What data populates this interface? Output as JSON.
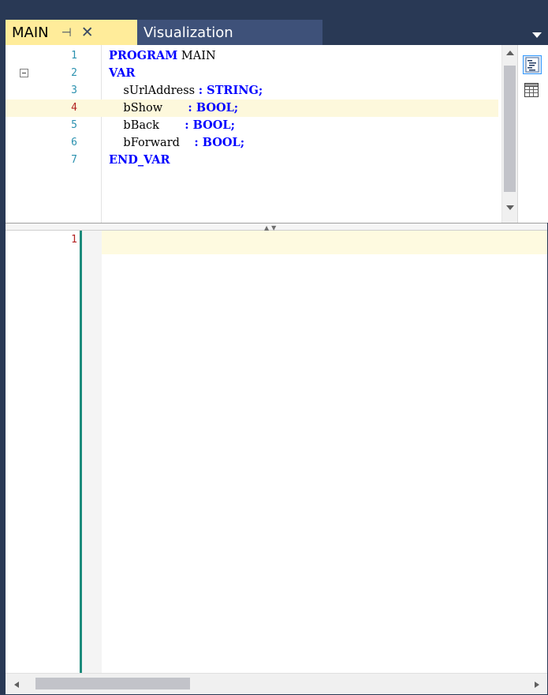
{
  "tabs": [
    {
      "label": "MAIN",
      "active": true,
      "pin_glyph": "⊣",
      "close_glyph": "✕"
    },
    {
      "label": "Visualization",
      "active": false
    }
  ],
  "declaration": {
    "lines": [
      {
        "num": "1",
        "tokens": [
          {
            "t": "kw",
            "v": "PROGRAM"
          },
          {
            "t": "id",
            "v": " MAIN"
          }
        ]
      },
      {
        "num": "2",
        "tokens": [
          {
            "t": "kw",
            "v": "VAR"
          }
        ]
      },
      {
        "num": "3",
        "tokens": [
          {
            "t": "id",
            "v": "    sUrlAddress "
          },
          {
            "t": "op",
            "v": ":"
          },
          {
            "t": "ty",
            "v": " STRING;"
          }
        ]
      },
      {
        "num": "4",
        "tokens": [
          {
            "t": "id",
            "v": "    bShow       "
          },
          {
            "t": "op",
            "v": ":"
          },
          {
            "t": "ty",
            "v": " BOOL;"
          }
        ]
      },
      {
        "num": "5",
        "tokens": [
          {
            "t": "id",
            "v": "    bBack       "
          },
          {
            "t": "op",
            "v": ":"
          },
          {
            "t": "ty",
            "v": " BOOL;"
          }
        ]
      },
      {
        "num": "6",
        "tokens": [
          {
            "t": "id",
            "v": "    bForward    "
          },
          {
            "t": "op",
            "v": ":"
          },
          {
            "t": "ty",
            "v": " BOOL;"
          }
        ]
      },
      {
        "num": "7",
        "tokens": [
          {
            "t": "kw",
            "v": "END_VAR"
          }
        ]
      }
    ],
    "highlighted_line": "4"
  },
  "implementation": {
    "line_number": "1"
  },
  "colors": {
    "frame": "#293955",
    "active_tab": "#ffec9a",
    "inactive_tab": "#3e5179",
    "keyword": "#0000ff",
    "line_number": "#2b91af",
    "current_line_number": "#b22222",
    "gutter_bar": "#1b8a7b"
  },
  "icons": {
    "tab_pin": "pin-icon",
    "tab_close": "close-icon",
    "tab_dropdown": "chevron-down-icon",
    "fold": "collapse-minus-icon",
    "textual_view": "text-view-icon",
    "tabular_view": "table-view-icon"
  }
}
